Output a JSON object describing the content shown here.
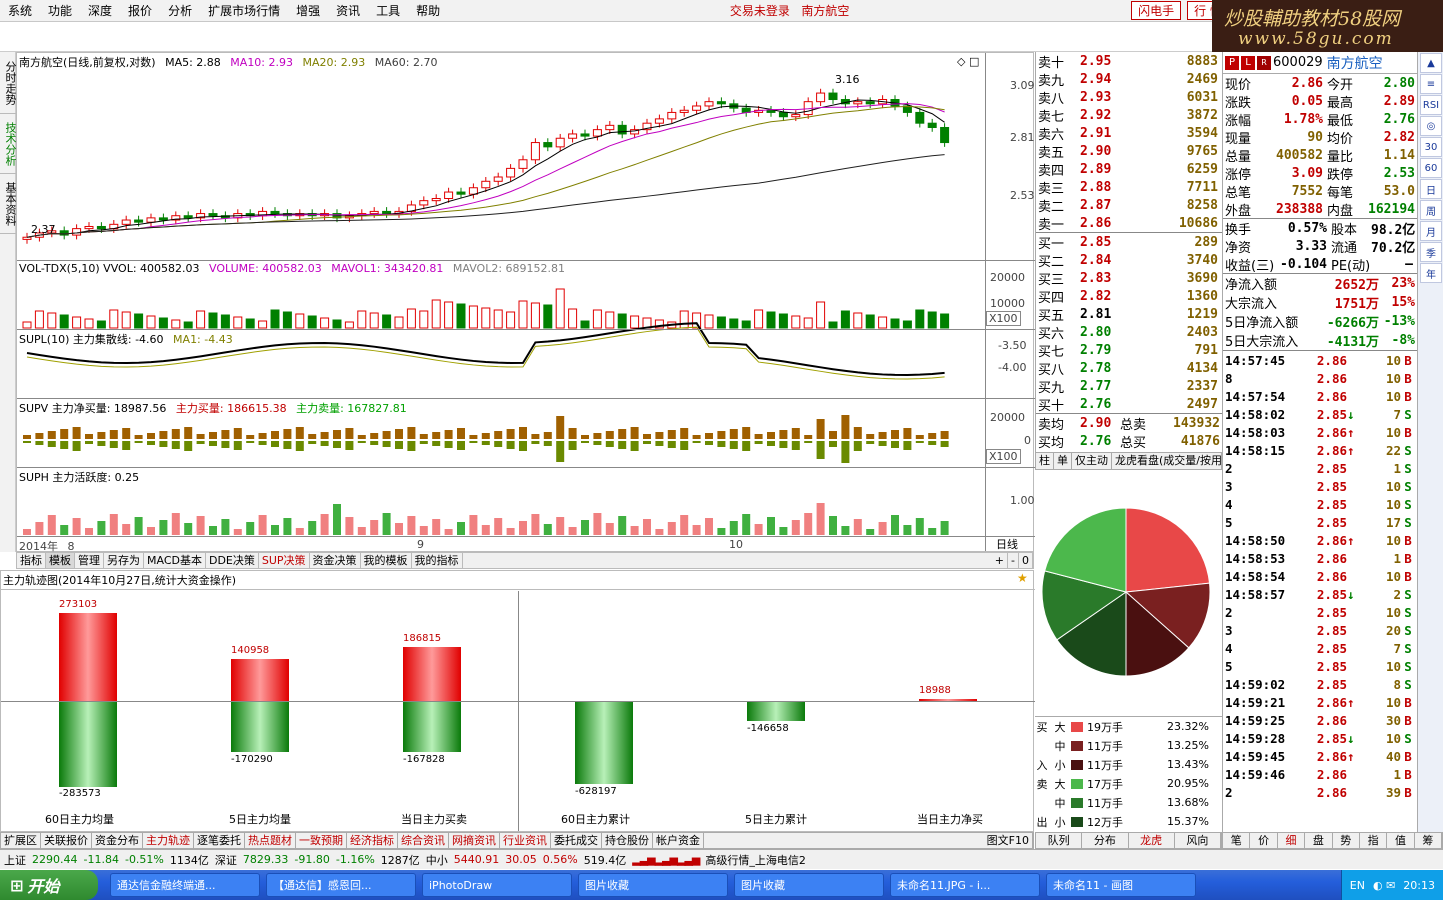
{
  "menu": {
    "items": [
      "系统",
      "功能",
      "深度",
      "报价",
      "分析",
      "扩展市场行情",
      "增强",
      "资讯",
      "工具",
      "帮助"
    ],
    "center": [
      "交易未登录",
      "南方航空"
    ],
    "buttons": [
      "闪电手",
      "行 情"
    ]
  },
  "brand": {
    "line1": "炒股輔助教材58股网",
    "line2": "www.58gu.com"
  },
  "left_tabs": [
    "分时走势",
    "技术分析",
    "基本资料"
  ],
  "chart": {
    "title": "南方航空(日线,前复权,对数)",
    "ma": [
      {
        "label": "MA5: 2.88",
        "color": "#000000"
      },
      {
        "label": "MA10: 2.93",
        "color": "#c000c0"
      },
      {
        "label": "MA20: 2.93",
        "color": "#808000"
      },
      {
        "label": "MA60: 2.70",
        "color": "#404040"
      }
    ],
    "price_axis": [
      "3.09",
      "2.81",
      "2.53"
    ],
    "hi_label": "3.16",
    "lo_label": "2.37",
    "vol_title": [
      "VOL-TDX(5,10) VVOL: 400582.03",
      "VOLUME: 400582.03",
      "MAVOL1: 343420.81",
      "MAVOL2: 689152.81"
    ],
    "vol_axis": [
      "20000",
      "10000",
      "X100"
    ],
    "supl_title": [
      "SUPL(10) 主力集散线: -4.60",
      "MA1: -4.43"
    ],
    "supl_axis": [
      "-3.50",
      "-4.00"
    ],
    "supv_title": [
      "SUPV 主力净买量: 18987.56",
      "主力买量: 186615.38",
      "主力卖量: 167827.81"
    ],
    "supv_axis": [
      "20000",
      "0",
      "X100"
    ],
    "suph_title": "SUPH 主力活跃度: 0.25",
    "suph_axis": "1.00",
    "date_axis": [
      "2014年",
      "8",
      "9",
      "10"
    ],
    "period": "日线"
  },
  "chart_tabs": [
    "指标",
    "模板",
    "管理",
    "另存为",
    "MACD基本",
    "DDE决策",
    "SUP决策",
    "资金决策",
    "我的模板",
    "我的指标"
  ],
  "chart_tab_ctrl": [
    "+",
    "-",
    "0"
  ],
  "lower": {
    "title": "主力轨迹图(2014年10月27日,统计大资金操作)",
    "groups": [
      {
        "caption": "60日主力均量",
        "buy": 273103,
        "sell": -283573
      },
      {
        "caption": "5日主力均量",
        "buy": 140958,
        "sell": -170290
      },
      {
        "caption": "当日主力买卖",
        "buy": 186815,
        "sell": -167828
      }
    ],
    "cumul": [
      {
        "caption": "60日主力累计",
        "value": -628197
      },
      {
        "caption": "5日主力累计",
        "value": -146658
      },
      {
        "caption": "当日主力净买",
        "value": 18988
      }
    ],
    "labels": {
      "g1b": "273103",
      "g1s": "-283573",
      "g2b": "140958",
      "g2s": "-170290",
      "g3b": "186815",
      "g3s": "-167828",
      "c1": "-628197",
      "c2": "-146658",
      "c3": "18988"
    }
  },
  "bottom_tabs": [
    "扩展区",
    "关联报价",
    "资金分布",
    "主力轨迹",
    "逐笔委托",
    "热点题材",
    "一致预期",
    "经济指标",
    "综合资讯",
    "网摘资讯",
    "行业资讯",
    "委托成交",
    "持仓股份",
    "帐户资金"
  ],
  "bottom_tab_right": "图文F10",
  "book": {
    "asks": [
      [
        "卖十",
        "2.95",
        "8883"
      ],
      [
        "卖九",
        "2.94",
        "2469"
      ],
      [
        "卖八",
        "2.93",
        "6031"
      ],
      [
        "卖七",
        "2.92",
        "3872"
      ],
      [
        "卖六",
        "2.91",
        "3594"
      ],
      [
        "卖五",
        "2.90",
        "9765"
      ],
      [
        "卖四",
        "2.89",
        "6259"
      ],
      [
        "卖三",
        "2.88",
        "7711"
      ],
      [
        "卖二",
        "2.87",
        "8258"
      ],
      [
        "卖一",
        "2.86",
        "10686"
      ]
    ],
    "bids": [
      [
        "买一",
        "2.85",
        "289"
      ],
      [
        "买二",
        "2.84",
        "3740"
      ],
      [
        "买三",
        "2.83",
        "3690"
      ],
      [
        "买四",
        "2.82",
        "1360"
      ],
      [
        "买五",
        "2.81",
        "1219"
      ],
      [
        "买六",
        "2.80",
        "2403"
      ],
      [
        "买七",
        "2.79",
        "791"
      ],
      [
        "买八",
        "2.78",
        "4134"
      ],
      [
        "买九",
        "2.77",
        "2337"
      ],
      [
        "买十",
        "2.76",
        "2497"
      ]
    ],
    "avg": [
      [
        "卖均",
        "2.90",
        "总卖",
        "143932"
      ],
      [
        "买均",
        "2.76",
        "总买",
        "41876"
      ]
    ]
  },
  "book_tabs": [
    "柱",
    "单",
    "仅主动",
    "龙虎看盘(成交量/按用"
  ],
  "pie": {
    "slices": [
      {
        "label": "买大",
        "percent": 23.32,
        "color": "#e84848"
      },
      {
        "label": "买中",
        "percent": 13.25,
        "color": "#7a2020"
      },
      {
        "label": "买小",
        "percent": 13.43,
        "color": "#4a1010"
      },
      {
        "label": "卖大",
        "percent": 20.95,
        "color": "#4cb84c"
      },
      {
        "label": "卖中",
        "percent": 13.68,
        "color": "#2a7a2a"
      },
      {
        "label": "卖小",
        "percent": 15.37,
        "color": "#1a4a1a"
      }
    ]
  },
  "flow": [
    {
      "side": "买",
      "size": "大",
      "hands": "19万手",
      "pct": "23.32%",
      "color": "#e84848"
    },
    {
      "side": "",
      "size": "中",
      "hands": "11万手",
      "pct": "13.25%",
      "color": "#7a2020"
    },
    {
      "side": "入",
      "size": "小",
      "hands": "11万手",
      "pct": "13.43%",
      "color": "#4a1010"
    },
    {
      "side": "卖",
      "size": "大",
      "hands": "17万手",
      "pct": "20.95%",
      "color": "#4cb84c"
    },
    {
      "side": "",
      "size": "中",
      "hands": "11万手",
      "pct": "13.68%",
      "color": "#2a7a2a"
    },
    {
      "side": "出",
      "size": "小",
      "hands": "12万手",
      "pct": "15.37%",
      "color": "#1a4a1a"
    }
  ],
  "right_tabs2": [
    "队列",
    "分布",
    "龙虎",
    "风向"
  ],
  "quote": {
    "code": "600029",
    "name": "南方航空",
    "pl": [
      "P",
      "L",
      "R"
    ],
    "rows": [
      [
        "现价",
        "2.86",
        "今开",
        "2.80"
      ],
      [
        "涨跌",
        "0.05",
        "最高",
        "2.89"
      ],
      [
        "涨幅",
        "1.78%",
        "最低",
        "2.76"
      ],
      [
        "现量",
        "90",
        "均价",
        "2.82"
      ],
      [
        "总量",
        "400582",
        "量比",
        "1.14"
      ],
      [
        "涨停",
        "3.09",
        "跌停",
        "2.53"
      ],
      [
        "总笔",
        "7552",
        "每笔",
        "53.0"
      ],
      [
        "外盘",
        "238388",
        "内盘",
        "162194"
      ]
    ],
    "rows2": [
      [
        "换手",
        "0.57%",
        "股本",
        "98.2亿"
      ],
      [
        "净资",
        "3.33",
        "流通",
        "70.2亿"
      ],
      [
        "收益(三)",
        "-0.104",
        "PE(动)",
        "–"
      ]
    ],
    "fund": [
      [
        "净流入额",
        "2652万",
        "23%"
      ],
      [
        "大宗流入",
        "1751万",
        "15%"
      ],
      [
        "5日净流入额",
        "-6266万",
        "-13%"
      ],
      [
        "5日大宗流入",
        "-4131万",
        "-8%"
      ]
    ],
    "ticks": [
      [
        "14:57:45",
        "2.86",
        "",
        "10",
        "B"
      ],
      [
        "8",
        "2.86",
        "",
        "10",
        "B"
      ],
      [
        "14:57:54",
        "2.86",
        "",
        "10",
        "B"
      ],
      [
        "14:58:02",
        "2.85",
        "↓",
        "7",
        "S"
      ],
      [
        "14:58:03",
        "2.86",
        "↑",
        "10",
        "B"
      ],
      [
        "14:58:15",
        "2.86",
        "↑",
        "22",
        "S"
      ],
      [
        "2",
        "2.85",
        "",
        "1",
        "S"
      ],
      [
        "3",
        "2.85",
        "",
        "10",
        "S"
      ],
      [
        "4",
        "2.85",
        "",
        "10",
        "S"
      ],
      [
        "5",
        "2.85",
        "",
        "17",
        "S"
      ],
      [
        "14:58:50",
        "2.86",
        "↑",
        "10",
        "B"
      ],
      [
        "14:58:53",
        "2.86",
        "",
        "1",
        "B"
      ],
      [
        "14:58:54",
        "2.86",
        "",
        "10",
        "B"
      ],
      [
        "14:58:57",
        "2.85",
        "↓",
        "2",
        "S"
      ],
      [
        "2",
        "2.85",
        "",
        "10",
        "S"
      ],
      [
        "3",
        "2.85",
        "",
        "20",
        "S"
      ],
      [
        "4",
        "2.85",
        "",
        "7",
        "S"
      ],
      [
        "5",
        "2.85",
        "",
        "10",
        "S"
      ],
      [
        "14:59:02",
        "2.85",
        "",
        "8",
        "S"
      ],
      [
        "14:59:21",
        "2.86",
        "↑",
        "10",
        "B"
      ],
      [
        "14:59:25",
        "2.86",
        "",
        "30",
        "B"
      ],
      [
        "14:59:28",
        "2.85",
        "↓",
        "10",
        "S"
      ],
      [
        "14:59:45",
        "2.86",
        "↑",
        "40",
        "B"
      ],
      [
        "14:59:46",
        "2.86",
        "",
        "1",
        "B"
      ],
      [
        "2",
        "2.86",
        "",
        "39",
        "B"
      ]
    ]
  },
  "quote_tabs": [
    "笔",
    "价",
    "细",
    "盘",
    "势",
    "指",
    "值",
    "筹"
  ],
  "iconbar": [
    "▲",
    "≡",
    "RSI",
    "◎",
    "30",
    "60",
    "日",
    "周",
    "月",
    "季",
    "年"
  ],
  "status": {
    "sh": [
      "上证",
      "2290.44",
      "-11.84",
      "-0.51%",
      "1134亿"
    ],
    "sz": [
      "深证",
      "7829.33",
      "-91.80",
      "-1.16%",
      "1287亿"
    ],
    "sm": [
      "中小",
      "5440.91",
      "30.05",
      "0.56%",
      "519.4亿"
    ],
    "feed": "高级行情_上海电信2"
  },
  "taskbar": {
    "start": "开始",
    "tasks": [
      "通达信金融终端通...",
      "【通达信】感恩回...",
      "iPhotoDraw",
      "图片收藏",
      "图片收藏",
      "未命名11.JPG - i...",
      "未命名11 - 画图"
    ],
    "clock": "20:13",
    "lang": "EN"
  }
}
